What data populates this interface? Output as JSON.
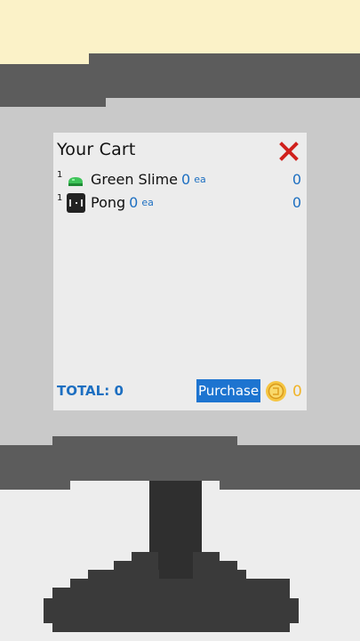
{
  "cart": {
    "title": "Your Cart",
    "items": [
      {
        "qty": "1",
        "name": "Green Slime",
        "price": "0",
        "unit": "ea",
        "total": "0",
        "icon": "green-slime-icon"
      },
      {
        "qty": "1",
        "name": "Pong",
        "price": "0",
        "unit": "ea",
        "total": "0",
        "icon": "pong-icon"
      }
    ],
    "total_label": "TOTAL: 0",
    "purchase_label": "Purchase",
    "coins": "0"
  },
  "colors": {
    "accent_blue": "#1d74d0",
    "price_blue": "#1d6fc1",
    "close_red": "#d0201c",
    "coin_gold": "#f0b429"
  }
}
